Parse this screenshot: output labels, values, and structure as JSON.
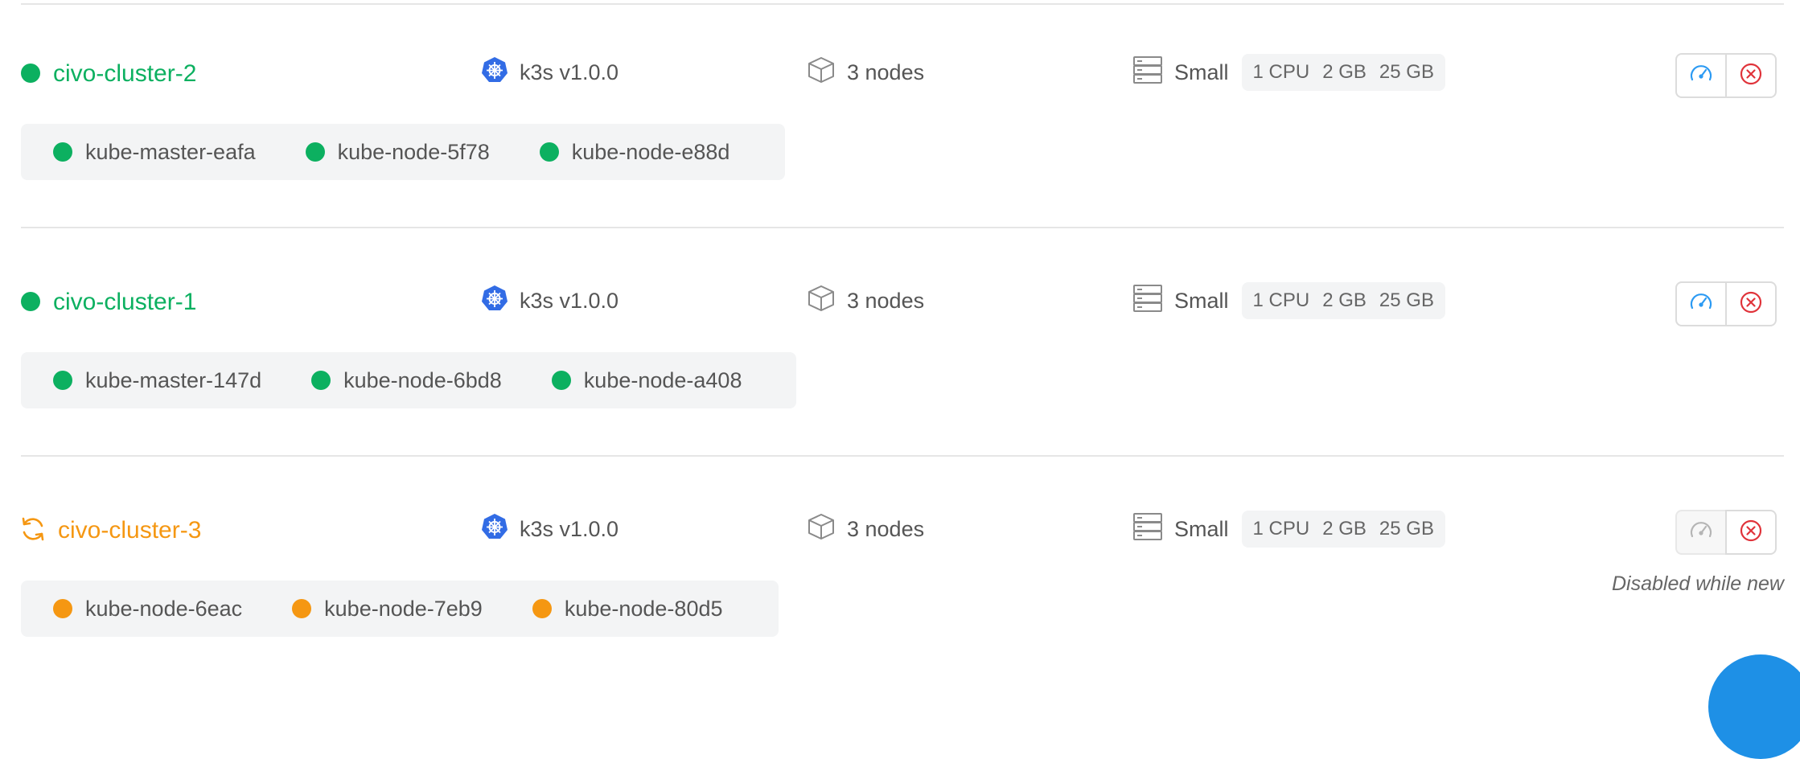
{
  "colors": {
    "ok": "#0cb060",
    "pending": "#f59712",
    "k8s_blue": "#326ce5",
    "dashboard_blue": "#2b9af3",
    "delete_red": "#e0333a",
    "muted_gray": "#b5b5b5"
  },
  "clusters": [
    {
      "name": "civo-cluster-2",
      "status": "active",
      "status_icon": "status-dot",
      "version": "k3s v1.0.0",
      "node_count": "3 nodes",
      "size": "Small",
      "specs": [
        "1 CPU",
        "2 GB",
        "25 GB"
      ],
      "nodes": [
        "kube-master-eafa",
        "kube-node-5f78",
        "kube-node-e88d"
      ],
      "dashboard_enabled": true,
      "dashboard_icon": "gauge-icon",
      "delete_icon": "close-circle-icon"
    },
    {
      "name": "civo-cluster-1",
      "status": "active",
      "status_icon": "status-dot",
      "version": "k3s v1.0.0",
      "node_count": "3 nodes",
      "size": "Small",
      "specs": [
        "1 CPU",
        "2 GB",
        "25 GB"
      ],
      "nodes": [
        "kube-master-147d",
        "kube-node-6bd8",
        "kube-node-a408"
      ],
      "dashboard_enabled": true,
      "dashboard_icon": "gauge-icon",
      "delete_icon": "close-circle-icon"
    },
    {
      "name": "civo-cluster-3",
      "status": "building",
      "status_icon": "refresh-icon",
      "version": "k3s v1.0.0",
      "node_count": "3 nodes",
      "size": "Small",
      "specs": [
        "1 CPU",
        "2 GB",
        "25 GB"
      ],
      "nodes": [
        "kube-node-6eac",
        "kube-node-7eb9",
        "kube-node-80d5"
      ],
      "dashboard_enabled": false,
      "dashboard_icon": "gauge-icon",
      "delete_icon": "close-circle-icon",
      "note": "Disabled while new"
    }
  ],
  "icons": {
    "version": "kubernetes-icon",
    "nodes": "cube-icon",
    "size": "server-icon"
  },
  "fab_icon": "floating-action-button"
}
